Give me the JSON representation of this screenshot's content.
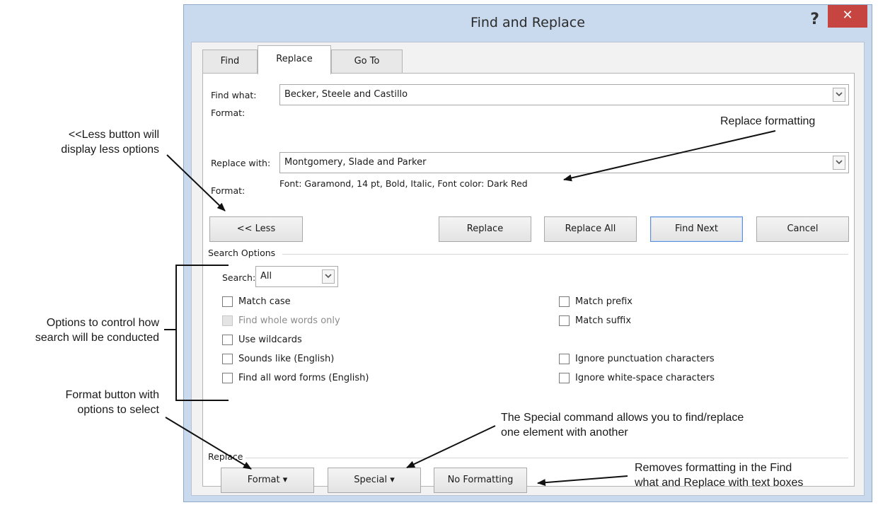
{
  "dialog": {
    "title": "Find and Replace",
    "help_label": "?",
    "close_label": "✕",
    "tabs": [
      {
        "label": "Find",
        "active": false
      },
      {
        "label": "Replace",
        "active": true
      },
      {
        "label": "Go To",
        "active": false
      }
    ],
    "find_what": {
      "label": "Find what:",
      "value": "Becker, Steele and Castillo",
      "format_label": "Format:",
      "format_value": ""
    },
    "replace_with": {
      "label": "Replace with:",
      "value": "Montgomery, Slade and Parker",
      "format_label": "Format:",
      "format_value": "Font: Garamond, 14 pt, Bold, Italic, Font color: Dark Red"
    },
    "buttons": {
      "less": "<< Less",
      "replace": "Replace",
      "replace_all": "Replace All",
      "find_next": "Find Next",
      "cancel": "Cancel"
    },
    "search_options": {
      "group_label": "Search Options",
      "search_label": "Search:",
      "search_value": "All",
      "left_options": [
        {
          "label": "Match case",
          "checked": false,
          "disabled": false
        },
        {
          "label": "Find whole words only",
          "checked": false,
          "disabled": true
        },
        {
          "label": "Use wildcards",
          "checked": false,
          "disabled": false
        },
        {
          "label": "Sounds like (English)",
          "checked": false,
          "disabled": false
        },
        {
          "label": "Find all word forms (English)",
          "checked": false,
          "disabled": false
        }
      ],
      "right_options": [
        {
          "label": "Match prefix",
          "checked": false
        },
        {
          "label": "Match suffix",
          "checked": false
        },
        {
          "label": "Ignore punctuation characters",
          "checked": false
        },
        {
          "label": "Ignore white-space characters",
          "checked": false
        }
      ]
    },
    "replace_group": {
      "group_label": "Replace",
      "format_button": "Format ▾",
      "special_button": "Special ▾",
      "no_formatting_button": "No Formatting"
    }
  },
  "annotations": {
    "less_note": [
      "<<Less button will",
      "display less options"
    ],
    "replace_formatting_note": "Replace formatting",
    "options_note": [
      "Options to control how",
      "search will be conducted"
    ],
    "format_note": [
      "Format button with",
      "options to select"
    ],
    "special_note": [
      "The Special command allows you to find/replace",
      "one element with another"
    ],
    "no_formatting_note": [
      "Removes formatting in the Find",
      "what and Replace with text boxes"
    ]
  },
  "colors": {
    "close_button": "#c64541",
    "window_frame": "#c9d9ee",
    "default_button_border": "#5d8fd6"
  }
}
